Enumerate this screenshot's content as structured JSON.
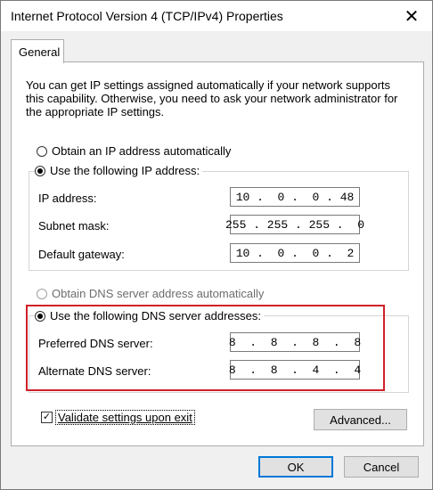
{
  "window": {
    "title": "Internet Protocol Version 4 (TCP/IPv4) Properties",
    "close_glyph": "✕"
  },
  "tabs": [
    {
      "label": "General"
    }
  ],
  "description": "You can get IP settings assigned automatically if your network supports this capability. Otherwise, you need to ask your network administrator for the appropriate IP settings.",
  "ip_section": {
    "auto_label": "Obtain an IP address automatically",
    "manual_label": "Use the following IP address:",
    "fields": [
      {
        "label": "IP address:",
        "value": "10 .  0 .  0 . 48"
      },
      {
        "label": "Subnet mask:",
        "value": "255 . 255 . 255 .  0"
      },
      {
        "label": "Default gateway:",
        "value": "10 .  0 .  0 .  2"
      }
    ]
  },
  "dns_section": {
    "auto_label": "Obtain DNS server address automatically",
    "manual_label": "Use the following DNS server addresses:",
    "fields": [
      {
        "label": "Preferred DNS server:",
        "value": "8  .  8  .  8  .  8"
      },
      {
        "label": "Alternate DNS server:",
        "value": "8  .  8  .  4  .  4"
      }
    ]
  },
  "validate_label": "Validate settings upon exit",
  "validate_check_glyph": "✓",
  "buttons": {
    "advanced": "Advanced...",
    "ok": "OK",
    "cancel": "Cancel"
  },
  "colors": {
    "highlight": "#d0202a",
    "focus": "#0078d7"
  }
}
